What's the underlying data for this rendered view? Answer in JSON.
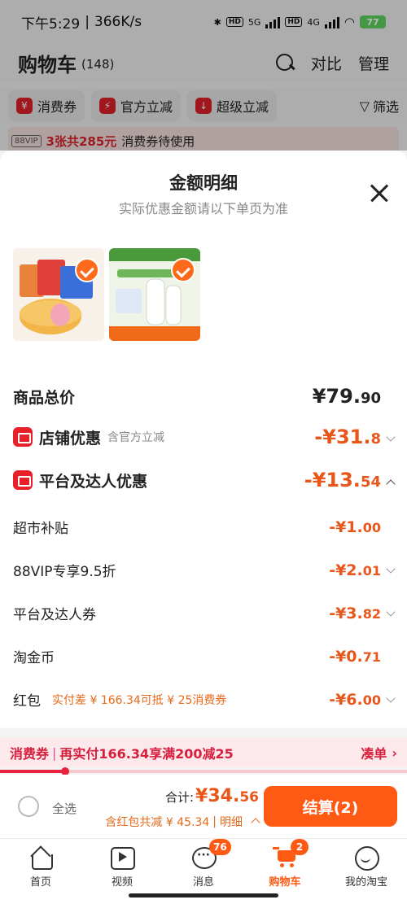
{
  "status_bar": {
    "time": "下午5:29",
    "speed": "366K/s",
    "network_1": "5G",
    "network_2": "4G",
    "hd": "HD",
    "battery": "77"
  },
  "header": {
    "title": "购物车",
    "count": "(148)",
    "compare": "对比",
    "manage": "管理"
  },
  "filters": {
    "chips": [
      {
        "label": "消费券",
        "icon": "¥"
      },
      {
        "label": "官方立减",
        "icon": "⚡"
      },
      {
        "label": "超级立减",
        "icon": "↓"
      }
    ],
    "filter_label": "筛选"
  },
  "vip_bar": {
    "tag": "88VIP",
    "highlight": "3张共285元",
    "text": "消费券待使用"
  },
  "sheet": {
    "title": "金额明细",
    "subtitle": "实际优惠金额请以下单页为准",
    "products": [
      {
        "name": "cake-product",
        "checked": true
      },
      {
        "name": "milk-product",
        "checked": true
      }
    ],
    "rows": {
      "total": {
        "label": "商品总价",
        "int": "¥79.",
        "dec": "90"
      },
      "shop": {
        "label": "店铺优惠",
        "note": "含官方立减",
        "int": "-¥31.",
        "dec": "8"
      },
      "platform": {
        "label": "平台及达人优惠",
        "int": "-¥13.",
        "dec": "54"
      },
      "supermarket": {
        "label": "超市补贴",
        "int": "-¥1.",
        "dec": "00"
      },
      "vip": {
        "label": "88VIP专享9.5折",
        "int": "-¥2.",
        "dec": "01"
      },
      "coupon": {
        "label": "平台及达人券",
        "int": "-¥3.",
        "dec": "82"
      },
      "coins": {
        "label": "淘金币",
        "int": "-¥0.",
        "dec": "71"
      },
      "redpack": {
        "label": "红包",
        "note": "实付差 ¥ 166.34可抵 ¥ 25消费券",
        "int": "-¥6.",
        "dec": "00"
      }
    }
  },
  "coupon_bar": {
    "tag": "消费券",
    "text": "再实付166.34享满200减25",
    "link": "凑单",
    "progress": 0.16
  },
  "checkout": {
    "select_all": "全选",
    "total_label": "合计:",
    "total_int": "¥34.",
    "total_dec": "56",
    "saved": "含红包共减 ¥ 45.34",
    "detail": "明细",
    "button": "结算(2)"
  },
  "tabbar": {
    "tabs": [
      {
        "label": "首页",
        "badge": ""
      },
      {
        "label": "视频",
        "badge": ""
      },
      {
        "label": "消息",
        "badge": "76"
      },
      {
        "label": "购物车",
        "badge": "2"
      },
      {
        "label": "我的淘宝",
        "badge": ""
      }
    ]
  },
  "colors": {
    "accent": "#ff5a14",
    "discount": "#e8561a",
    "coupon_red": "#d61f3c"
  }
}
